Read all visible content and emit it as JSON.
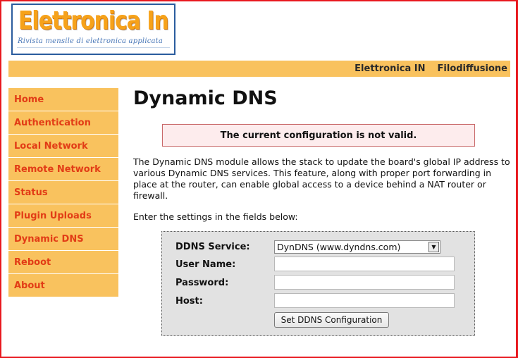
{
  "logo": {
    "title": "Elettronica In",
    "subtitle": "Rivista mensile di elettronica applicata"
  },
  "topbar": {
    "links": [
      "Elettronica IN",
      "Filodiffusione"
    ]
  },
  "sidebar": {
    "items": [
      {
        "label": "Home"
      },
      {
        "label": "Authentication"
      },
      {
        "label": "Local Network"
      },
      {
        "label": "Remote Network"
      },
      {
        "label": "Status"
      },
      {
        "label": "Plugin Uploads"
      },
      {
        "label": "Dynamic DNS"
      },
      {
        "label": "Reboot"
      },
      {
        "label": "About"
      }
    ]
  },
  "main": {
    "title": "Dynamic DNS",
    "error": "The current configuration is not valid.",
    "description": "The Dynamic DNS module allows the stack to update the board's global IP address to various Dynamic DNS services. This feature, along with proper port forwarding in place at the router, can enable global access to a device behind a NAT router or firewall.",
    "instructions": "Enter the settings in the fields below:"
  },
  "form": {
    "service_label": "DDNS Service:",
    "service_value": "DynDNS (www.dyndns.com)",
    "username_label": "User Name:",
    "username_value": "",
    "password_label": "Password:",
    "password_value": "",
    "host_label": "Host:",
    "host_value": "",
    "submit_label": "Set DDNS Configuration"
  },
  "colors": {
    "accent": "#f9c25e",
    "nav_text": "#e23c16",
    "frame": "#e8191f",
    "error_bg": "#fdeced"
  }
}
